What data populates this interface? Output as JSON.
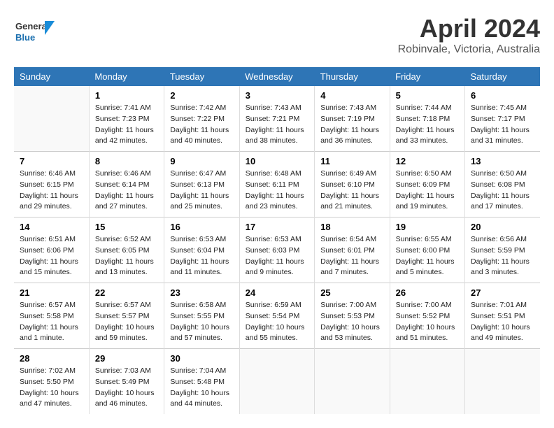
{
  "header": {
    "logo_general": "General",
    "logo_blue": "Blue",
    "title": "April 2024",
    "location": "Robinvale, Victoria, Australia"
  },
  "calendar": {
    "weekdays": [
      "Sunday",
      "Monday",
      "Tuesday",
      "Wednesday",
      "Thursday",
      "Friday",
      "Saturday"
    ],
    "weeks": [
      [
        {
          "day": "",
          "sunrise": "",
          "sunset": "",
          "daylight": ""
        },
        {
          "day": "1",
          "sunrise": "Sunrise: 7:41 AM",
          "sunset": "Sunset: 7:23 PM",
          "daylight": "Daylight: 11 hours and 42 minutes."
        },
        {
          "day": "2",
          "sunrise": "Sunrise: 7:42 AM",
          "sunset": "Sunset: 7:22 PM",
          "daylight": "Daylight: 11 hours and 40 minutes."
        },
        {
          "day": "3",
          "sunrise": "Sunrise: 7:43 AM",
          "sunset": "Sunset: 7:21 PM",
          "daylight": "Daylight: 11 hours and 38 minutes."
        },
        {
          "day": "4",
          "sunrise": "Sunrise: 7:43 AM",
          "sunset": "Sunset: 7:19 PM",
          "daylight": "Daylight: 11 hours and 36 minutes."
        },
        {
          "day": "5",
          "sunrise": "Sunrise: 7:44 AM",
          "sunset": "Sunset: 7:18 PM",
          "daylight": "Daylight: 11 hours and 33 minutes."
        },
        {
          "day": "6",
          "sunrise": "Sunrise: 7:45 AM",
          "sunset": "Sunset: 7:17 PM",
          "daylight": "Daylight: 11 hours and 31 minutes."
        }
      ],
      [
        {
          "day": "7",
          "sunrise": "Sunrise: 6:46 AM",
          "sunset": "Sunset: 6:15 PM",
          "daylight": "Daylight: 11 hours and 29 minutes."
        },
        {
          "day": "8",
          "sunrise": "Sunrise: 6:46 AM",
          "sunset": "Sunset: 6:14 PM",
          "daylight": "Daylight: 11 hours and 27 minutes."
        },
        {
          "day": "9",
          "sunrise": "Sunrise: 6:47 AM",
          "sunset": "Sunset: 6:13 PM",
          "daylight": "Daylight: 11 hours and 25 minutes."
        },
        {
          "day": "10",
          "sunrise": "Sunrise: 6:48 AM",
          "sunset": "Sunset: 6:11 PM",
          "daylight": "Daylight: 11 hours and 23 minutes."
        },
        {
          "day": "11",
          "sunrise": "Sunrise: 6:49 AM",
          "sunset": "Sunset: 6:10 PM",
          "daylight": "Daylight: 11 hours and 21 minutes."
        },
        {
          "day": "12",
          "sunrise": "Sunrise: 6:50 AM",
          "sunset": "Sunset: 6:09 PM",
          "daylight": "Daylight: 11 hours and 19 minutes."
        },
        {
          "day": "13",
          "sunrise": "Sunrise: 6:50 AM",
          "sunset": "Sunset: 6:08 PM",
          "daylight": "Daylight: 11 hours and 17 minutes."
        }
      ],
      [
        {
          "day": "14",
          "sunrise": "Sunrise: 6:51 AM",
          "sunset": "Sunset: 6:06 PM",
          "daylight": "Daylight: 11 hours and 15 minutes."
        },
        {
          "day": "15",
          "sunrise": "Sunrise: 6:52 AM",
          "sunset": "Sunset: 6:05 PM",
          "daylight": "Daylight: 11 hours and 13 minutes."
        },
        {
          "day": "16",
          "sunrise": "Sunrise: 6:53 AM",
          "sunset": "Sunset: 6:04 PM",
          "daylight": "Daylight: 11 hours and 11 minutes."
        },
        {
          "day": "17",
          "sunrise": "Sunrise: 6:53 AM",
          "sunset": "Sunset: 6:03 PM",
          "daylight": "Daylight: 11 hours and 9 minutes."
        },
        {
          "day": "18",
          "sunrise": "Sunrise: 6:54 AM",
          "sunset": "Sunset: 6:01 PM",
          "daylight": "Daylight: 11 hours and 7 minutes."
        },
        {
          "day": "19",
          "sunrise": "Sunrise: 6:55 AM",
          "sunset": "Sunset: 6:00 PM",
          "daylight": "Daylight: 11 hours and 5 minutes."
        },
        {
          "day": "20",
          "sunrise": "Sunrise: 6:56 AM",
          "sunset": "Sunset: 5:59 PM",
          "daylight": "Daylight: 11 hours and 3 minutes."
        }
      ],
      [
        {
          "day": "21",
          "sunrise": "Sunrise: 6:57 AM",
          "sunset": "Sunset: 5:58 PM",
          "daylight": "Daylight: 11 hours and 1 minute."
        },
        {
          "day": "22",
          "sunrise": "Sunrise: 6:57 AM",
          "sunset": "Sunset: 5:57 PM",
          "daylight": "Daylight: 10 hours and 59 minutes."
        },
        {
          "day": "23",
          "sunrise": "Sunrise: 6:58 AM",
          "sunset": "Sunset: 5:55 PM",
          "daylight": "Daylight: 10 hours and 57 minutes."
        },
        {
          "day": "24",
          "sunrise": "Sunrise: 6:59 AM",
          "sunset": "Sunset: 5:54 PM",
          "daylight": "Daylight: 10 hours and 55 minutes."
        },
        {
          "day": "25",
          "sunrise": "Sunrise: 7:00 AM",
          "sunset": "Sunset: 5:53 PM",
          "daylight": "Daylight: 10 hours and 53 minutes."
        },
        {
          "day": "26",
          "sunrise": "Sunrise: 7:00 AM",
          "sunset": "Sunset: 5:52 PM",
          "daylight": "Daylight: 10 hours and 51 minutes."
        },
        {
          "day": "27",
          "sunrise": "Sunrise: 7:01 AM",
          "sunset": "Sunset: 5:51 PM",
          "daylight": "Daylight: 10 hours and 49 minutes."
        }
      ],
      [
        {
          "day": "28",
          "sunrise": "Sunrise: 7:02 AM",
          "sunset": "Sunset: 5:50 PM",
          "daylight": "Daylight: 10 hours and 47 minutes."
        },
        {
          "day": "29",
          "sunrise": "Sunrise: 7:03 AM",
          "sunset": "Sunset: 5:49 PM",
          "daylight": "Daylight: 10 hours and 46 minutes."
        },
        {
          "day": "30",
          "sunrise": "Sunrise: 7:04 AM",
          "sunset": "Sunset: 5:48 PM",
          "daylight": "Daylight: 10 hours and 44 minutes."
        },
        {
          "day": "",
          "sunrise": "",
          "sunset": "",
          "daylight": ""
        },
        {
          "day": "",
          "sunrise": "",
          "sunset": "",
          "daylight": ""
        },
        {
          "day": "",
          "sunrise": "",
          "sunset": "",
          "daylight": ""
        },
        {
          "day": "",
          "sunrise": "",
          "sunset": "",
          "daylight": ""
        }
      ]
    ]
  }
}
